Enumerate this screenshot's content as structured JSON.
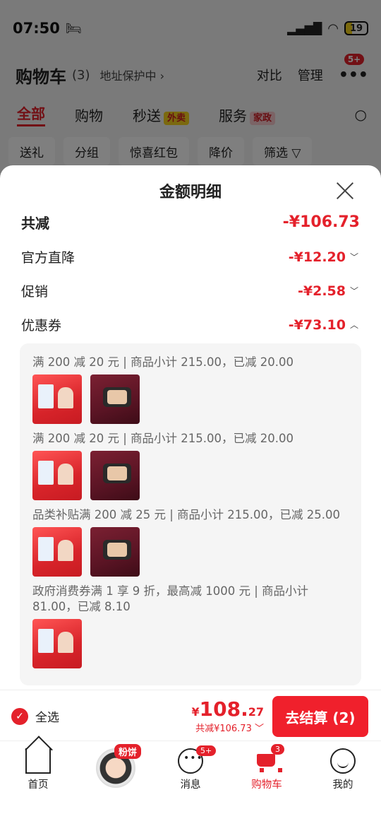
{
  "status_bar": {
    "time": "07:50",
    "battery": "19"
  },
  "header": {
    "title": "购物车",
    "count": "(3)",
    "address": "地址保护中 ›",
    "compare": "对比",
    "manage": "管理",
    "more_icon": "more-dots-icon",
    "more_badge": "5+"
  },
  "tabs": [
    {
      "label": "全部"
    },
    {
      "label": "购物"
    },
    {
      "label": "秒送",
      "tag": "外卖"
    },
    {
      "label": "服务",
      "tag": "家政"
    }
  ],
  "chips": [
    "送礼",
    "分组",
    "惊喜红包",
    "降价",
    "筛选"
  ],
  "sheet": {
    "title": "金额明细",
    "total_label": "共减",
    "total_value": "-¥106.73",
    "rows": [
      {
        "label": "官方直降",
        "value": "-¥12.20",
        "chevron": "chevron-down-icon"
      },
      {
        "label": "促销",
        "value": "-¥2.58",
        "chevron": "chevron-down-icon"
      },
      {
        "label": "优惠券",
        "value": "-¥73.10",
        "chevron": "chevron-up-icon"
      }
    ],
    "coupons": [
      {
        "text": "满 200 减 20 元 | 商品小计 215.00，已减 20.00",
        "thumbs": [
          "red",
          "dark"
        ]
      },
      {
        "text": "满 200 减 20 元 | 商品小计 215.00，已减 20.00",
        "thumbs": [
          "red",
          "dark"
        ]
      },
      {
        "text": "品类补贴满 200 减 25 元 | 商品小计 215.00，已减 25.00",
        "thumbs": [
          "red",
          "dark"
        ]
      },
      {
        "text": "政府消费券满 1 享 9 折，最高减 1000 元 | 商品小计 81.00，已减 8.10",
        "thumbs": [
          "red"
        ]
      }
    ]
  },
  "bottom_bar": {
    "select_all": "全选",
    "price_symbol": "¥",
    "price_int": "108.",
    "price_dec": "27",
    "discount": "共减¥106.73",
    "checkout": "去结算 (2)"
  },
  "tabbar": {
    "home": "首页",
    "center_tag": "粉饼",
    "messages": "消息",
    "messages_badge": "5+",
    "cart": "购物车",
    "cart_badge": "3",
    "me": "我的"
  },
  "colors": {
    "accent": "#e4212b",
    "tag_yellow": "#f7d21e",
    "tag_pink": "#f6c9cc"
  }
}
